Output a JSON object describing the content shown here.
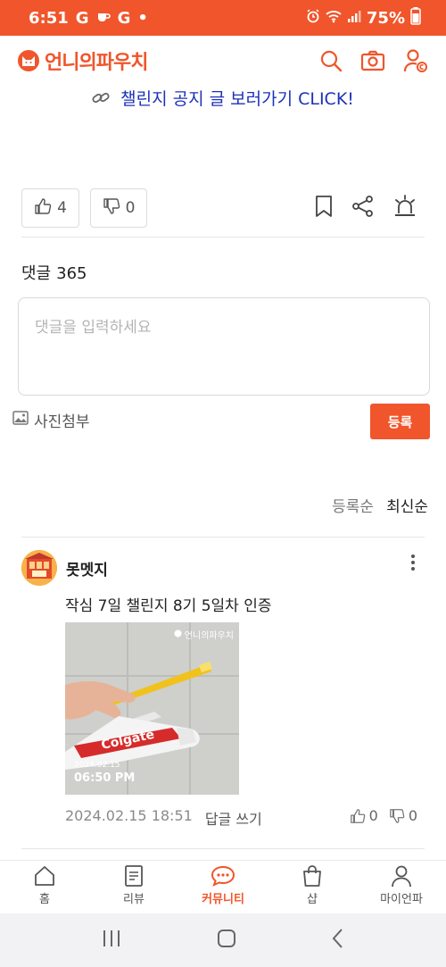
{
  "status_bar": {
    "time": "6:51",
    "notif_glyphs": [
      "G",
      "G"
    ],
    "dot": "•",
    "battery": "75%"
  },
  "header": {
    "app_name": "언니의파우치",
    "icons": [
      "search-icon",
      "camera-icon",
      "user-settings-icon"
    ]
  },
  "post": {
    "notice_link": "챌린지 공지 글 보러가기 CLICK!",
    "likes": "4",
    "dislikes": "0"
  },
  "comments_section": {
    "label": "댓글",
    "count": "365",
    "input_placeholder": "댓글을 입력하세요",
    "attach_label": "사진첨부",
    "submit_label": "등록",
    "sort_options": [
      "등록순",
      "최신순"
    ],
    "active_sort": "최신순"
  },
  "comments": [
    {
      "nickname": "못멧지",
      "text": "작심 7일 챌린지 8기 5일차 인증",
      "photo": {
        "watermark": "언니의파우치",
        "date": "2024.02.15",
        "time": "06:50 PM"
      },
      "timestamp": "2024.02.15 18:51",
      "reply_label": "답글 쓰기",
      "likes": "0",
      "dislikes": "0"
    }
  ],
  "bottom_nav": [
    {
      "label": "홈",
      "icon": "home-icon"
    },
    {
      "label": "리뷰",
      "icon": "review-icon"
    },
    {
      "label": "커뮤니티",
      "icon": "community-icon",
      "active": true
    },
    {
      "label": "샵",
      "icon": "shop-icon"
    },
    {
      "label": "마이언파",
      "icon": "profile-icon"
    }
  ],
  "colors": {
    "accent": "#f0552b",
    "link": "#1c31b8"
  }
}
